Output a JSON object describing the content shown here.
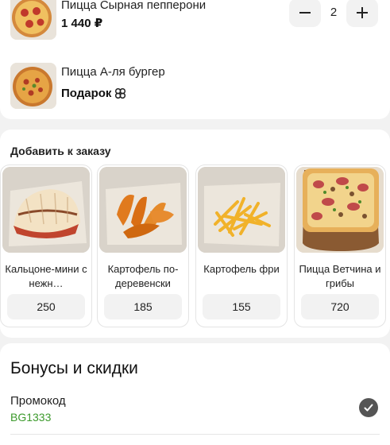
{
  "cart": {
    "items": [
      {
        "name": "Пицца Сырная пепперони",
        "price": "1 440 ₽",
        "quantity": "2",
        "icon": "pizza-pepperoni-image"
      },
      {
        "name": "Пицца А-ля бургер",
        "price": "Подарок",
        "icon": "pizza-burger-image",
        "badge_icon": "gift-icon"
      }
    ]
  },
  "upsell": {
    "title": "Добавить к заказу",
    "products": [
      {
        "name": "Кальцоне-мини с нежн…",
        "price": "250",
        "icon": "calzone-image"
      },
      {
        "name": "Картофель по-деревенски",
        "price": "185",
        "icon": "wedges-image"
      },
      {
        "name": "Картофель фри",
        "price": "155",
        "icon": "fries-image"
      },
      {
        "name": "Пицца Ветчина и грибы",
        "price": "720",
        "icon": "pizza-ham-mushroom-image"
      }
    ]
  },
  "bonuses": {
    "title": "Бонусы и скидки",
    "promo_label": "Промокод",
    "promo_code": "BG1333",
    "colors": {
      "promo": "#3c9a2c",
      "check": "#555555"
    }
  }
}
